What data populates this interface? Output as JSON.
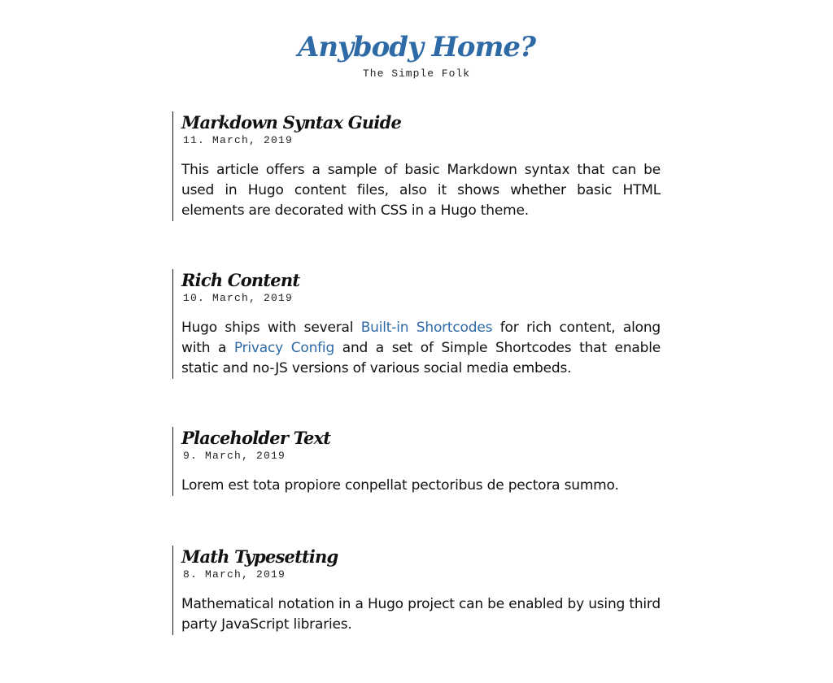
{
  "site": {
    "title": "Anybody Home?",
    "subtitle": "The Simple Folk"
  },
  "posts": [
    {
      "title": "Markdown Syntax Guide",
      "date": "11. March, 2019",
      "summary": "This article offers a sample of basic Markdown syntax that can be used in Hugo content files, also it shows whether basic HTML elements are decorated with CSS in a Hugo theme."
    },
    {
      "title": "Rich Content",
      "date": "10. March, 2019",
      "summary_parts": {
        "text1": "Hugo ships with several ",
        "link1": "Built-in Shortcodes",
        "text2": " for rich content, along with a ",
        "link2": "Privacy Config",
        "text3": " and a set of Simple Shortcodes that enable static and no-JS versions of various social media embeds."
      }
    },
    {
      "title": "Placeholder Text",
      "date": "9. March, 2019",
      "summary": "Lorem est tota propiore conpellat pectoribus de pectora summo."
    },
    {
      "title": "Math Typesetting",
      "date": "8. March, 2019",
      "summary": "Mathematical notation in a Hugo project can be enabled by using third party JavaScript libraries."
    }
  ]
}
